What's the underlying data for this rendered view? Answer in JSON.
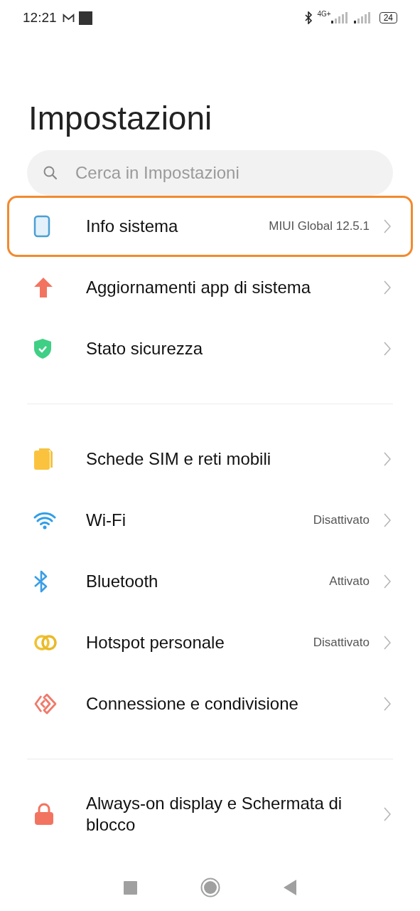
{
  "status_bar": {
    "time": "12:21",
    "network": "4G+",
    "battery": "24"
  },
  "title": "Impostazioni",
  "search": {
    "placeholder": "Cerca in Impostazioni"
  },
  "groups": [
    {
      "items": [
        {
          "label": "Info sistema",
          "value": "MIUI Global 12.5.1",
          "highlighted": true
        },
        {
          "label": "Aggiornamenti app di sistema",
          "highlighted": false
        },
        {
          "label": "Stato sicurezza",
          "highlighted": false
        }
      ]
    },
    {
      "items": [
        {
          "label": "Schede SIM e reti mobili",
          "highlighted": false
        },
        {
          "label": "Wi-Fi",
          "value": "Disattivato",
          "highlighted": false
        },
        {
          "label": "Bluetooth",
          "value": "Attivato",
          "highlighted": false
        },
        {
          "label": "Hotspot personale",
          "value": "Disattivato",
          "highlighted": false
        },
        {
          "label": "Connessione e condivisione",
          "highlighted": false
        }
      ]
    },
    {
      "items": [
        {
          "label": "Always-on display e Schermata di blocco",
          "highlighted": false
        }
      ]
    }
  ]
}
